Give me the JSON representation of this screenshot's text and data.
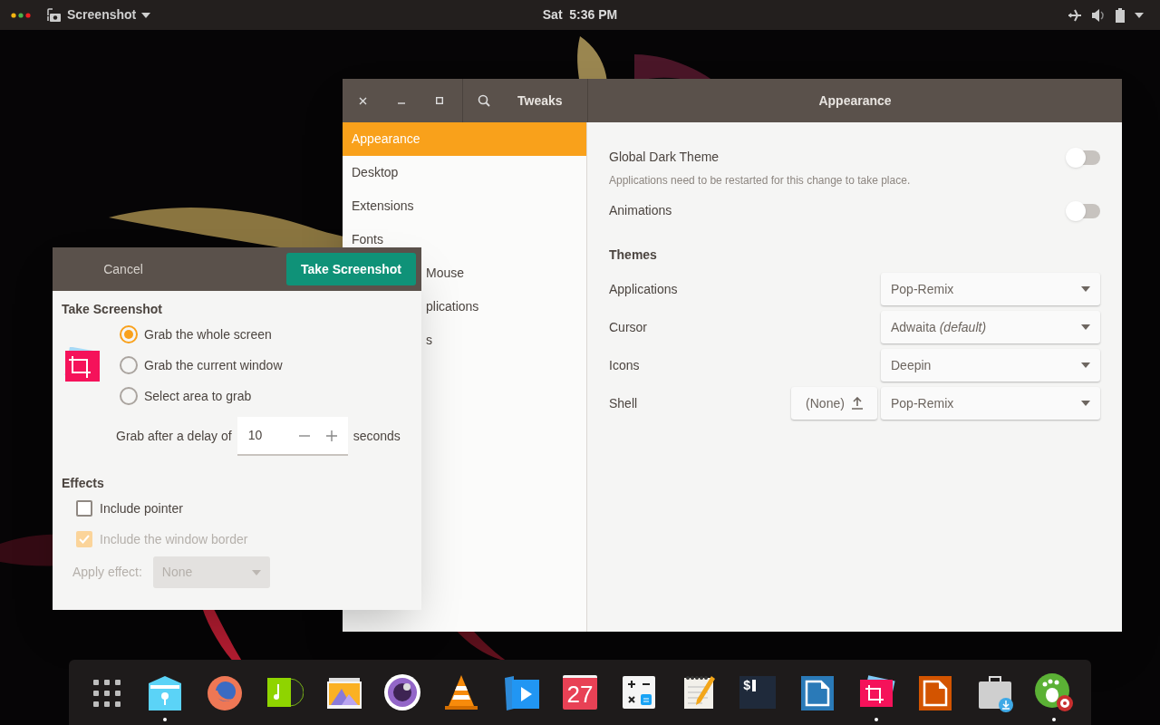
{
  "top_bar": {
    "app_menu": "Screenshot",
    "clock": "Sat  5:36 PM"
  },
  "tweaks_window": {
    "title": "Tweaks",
    "header_title": "Appearance",
    "sidebar": [
      {
        "label": "Appearance",
        "selected": true,
        "covered": false
      },
      {
        "label": "Desktop",
        "selected": false,
        "covered": false
      },
      {
        "label": "Extensions",
        "selected": false,
        "covered": false
      },
      {
        "label": "Fonts",
        "selected": false,
        "covered": false
      },
      {
        "label": "Mouse",
        "selected": false,
        "covered": true
      },
      {
        "label": "plications",
        "selected": false,
        "covered": true
      },
      {
        "label": "s",
        "selected": false,
        "covered": true
      }
    ],
    "toggles": [
      {
        "label": "Global Dark Theme",
        "hint": "Applications need to be restarted for this change to take place.",
        "on": false
      },
      {
        "label": "Animations",
        "on": false
      }
    ],
    "themes_heading": "Themes",
    "themes": [
      {
        "label": "Applications",
        "value": "Pop-Remix"
      },
      {
        "label": "Cursor",
        "value": "Adwaita *(default)*"
      },
      {
        "label": "Icons",
        "value": "Deepin"
      },
      {
        "label": "Shell",
        "value": "Pop-Remix",
        "extra": "(None)"
      }
    ]
  },
  "screenshot_dialog": {
    "cancel": "Cancel",
    "confirm": "Take Screenshot",
    "section": "Take Screenshot",
    "options": [
      {
        "label": "Grab the whole screen",
        "selected": true
      },
      {
        "label": "Grab the current window",
        "selected": false
      },
      {
        "label": "Select area to grab",
        "selected": false
      }
    ],
    "delay": {
      "label": "Grab after a delay of",
      "value": "10",
      "unit": "seconds"
    },
    "effects_heading": "Effects",
    "checks": [
      {
        "label": "Include pointer",
        "checked": false,
        "disabled": false
      },
      {
        "label": "Include the window border",
        "checked": true,
        "disabled": true
      }
    ],
    "apply_effect": {
      "label": "Apply effect:",
      "value": "None",
      "disabled": true
    }
  },
  "dock": [
    {
      "kind": "apps",
      "running": false
    },
    {
      "kind": "files",
      "running": true
    },
    {
      "kind": "browser",
      "running": false
    },
    {
      "kind": "music",
      "running": false
    },
    {
      "kind": "photos",
      "running": false
    },
    {
      "kind": "camera",
      "running": false
    },
    {
      "kind": "cone",
      "running": false
    },
    {
      "kind": "video",
      "running": false
    },
    {
      "kind": "calendar",
      "running": false,
      "text": "27"
    },
    {
      "kind": "calculator",
      "running": false
    },
    {
      "kind": "notes",
      "running": false
    },
    {
      "kind": "terminal",
      "running": false,
      "text": "$"
    },
    {
      "kind": "blue-doc",
      "running": false
    },
    {
      "kind": "screenshot",
      "running": true
    },
    {
      "kind": "orange-doc",
      "running": false
    },
    {
      "kind": "store",
      "running": false
    },
    {
      "kind": "tweaks",
      "running": true
    }
  ]
}
